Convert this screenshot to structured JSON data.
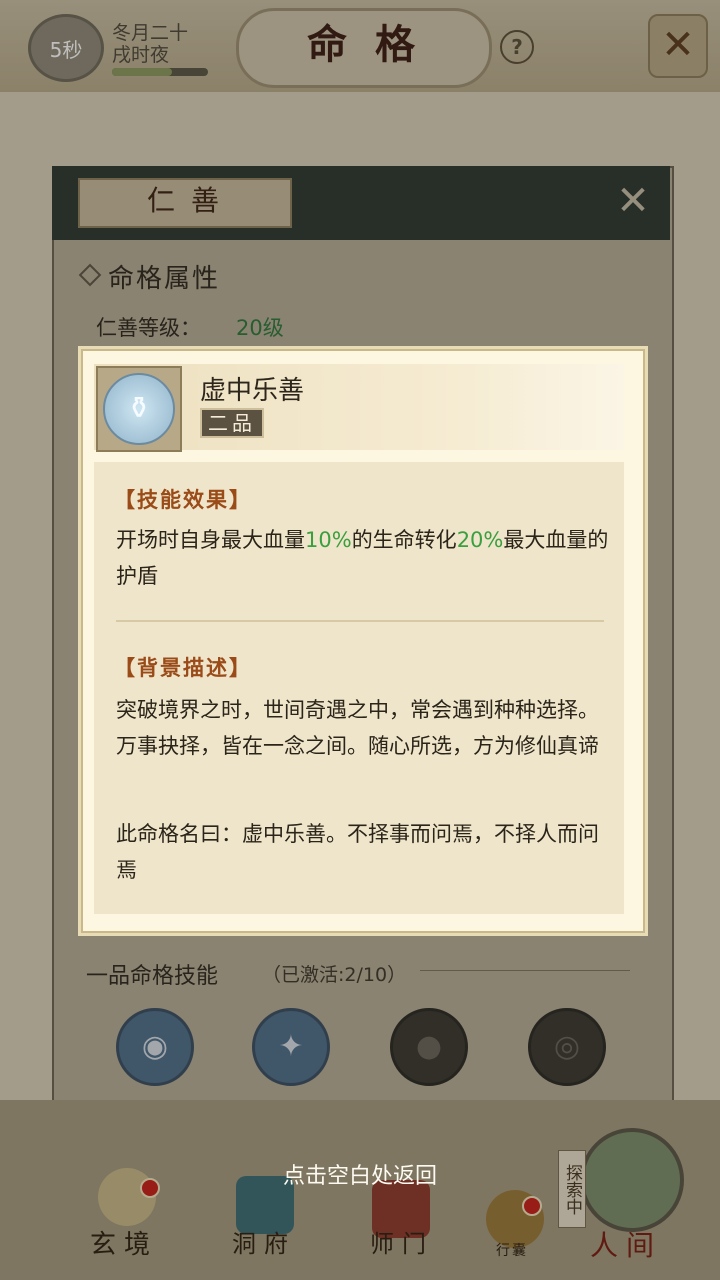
{
  "status": {
    "timer": "5秒",
    "date_line1": "冬月二十",
    "date_line2": "戌时夜",
    "time_progress": 0.62
  },
  "header": {
    "title": "命格",
    "help_icon": "?",
    "close_icon": "✕"
  },
  "panel": {
    "tab_title": "仁善",
    "close_icon": "✕",
    "attr_title": "命格属性",
    "level_label": "仁善等级：",
    "level_value": "20级",
    "skills_title": "一品命格技能",
    "skills_count": "（已激活:2/10）",
    "skill_icons": [
      "eye-spiral-icon",
      "shuriken-icon",
      "fist-icon",
      "eye-icon"
    ]
  },
  "popup": {
    "item_name": "虚中乐善",
    "grade": "二品",
    "effect_title": "【技能效果】",
    "effect_text_parts": {
      "p1": "开场时自身最大血量",
      "v1": "10%",
      "p2": "的生命转化",
      "v2": "20%",
      "p3": "最大血量的护盾"
    },
    "bg_title": "【背景描述】",
    "bg_text_1": "突破境界之时，世间奇遇之中，常会遇到种种选择。万事抉择，皆在一念之间。随心所选，方为修仙真谛",
    "bg_text_2": "此命格名曰：虚中乐善。不择事而问焉，不择人而问焉"
  },
  "footer": {
    "back_hint": "点击空白处返回",
    "nav": {
      "xuanjing": "玄境",
      "dongfu": "洞府",
      "shimen": "师门",
      "xingnang": "行囊",
      "renjian": "人间",
      "explore_tag": "探索中"
    }
  },
  "colors": {
    "highlight_green": "#3a9f3e",
    "section_title": "#9a4b18",
    "notification_red": "#c8201a"
  }
}
